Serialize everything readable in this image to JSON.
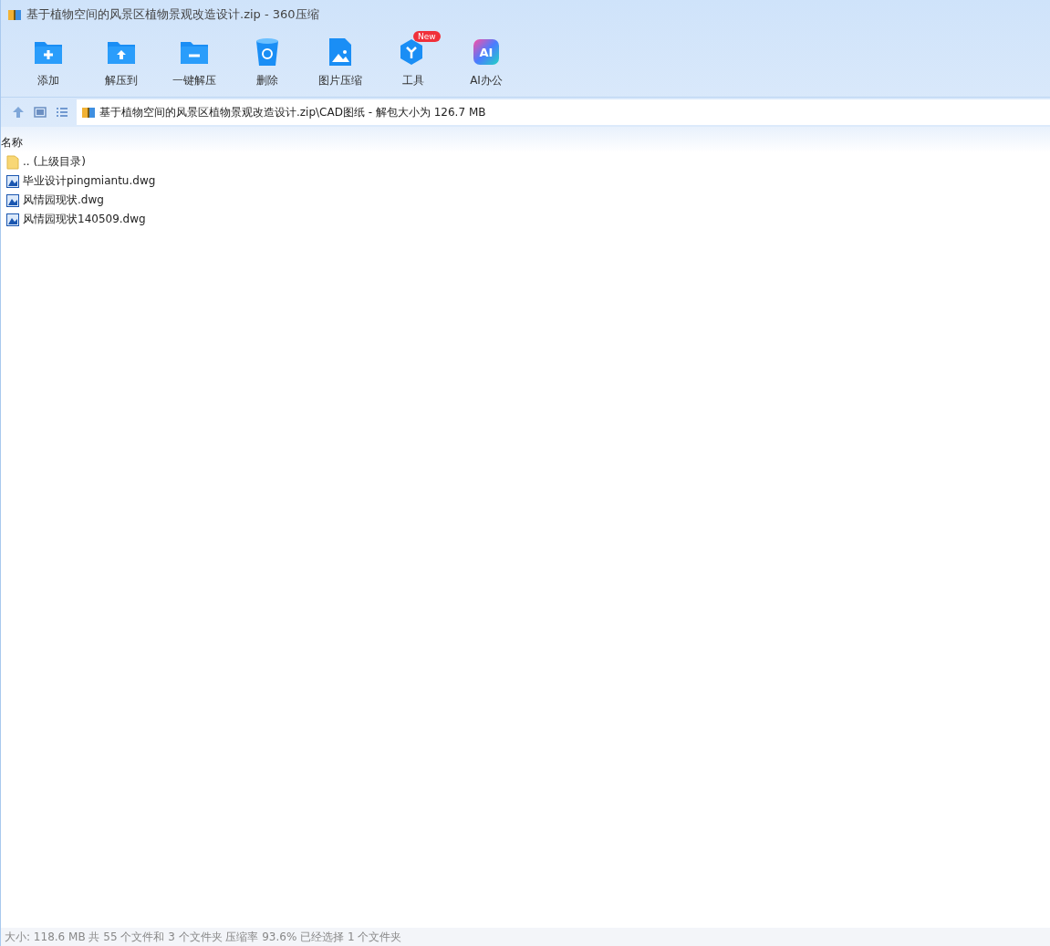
{
  "window": {
    "title": "基于植物空间的风景区植物景观改造设计.zip - 360压缩"
  },
  "toolbar": [
    {
      "kind": "add",
      "label": "添加"
    },
    {
      "kind": "extract-to",
      "label": "解压到"
    },
    {
      "kind": "one-click",
      "label": "一键解压"
    },
    {
      "kind": "delete",
      "label": "删除"
    },
    {
      "kind": "image",
      "label": "图片压缩"
    },
    {
      "kind": "tools",
      "label": "工具",
      "badge": "New"
    },
    {
      "kind": "ai",
      "label": "AI办公",
      "glyph": "AI"
    }
  ],
  "address": {
    "path": "基于植物空间的风景区植物景观改造设计.zip\\CAD图纸 - 解包大小为 126.7 MB"
  },
  "table": {
    "columns": [
      "名称"
    ],
    "rows": [
      {
        "kind": "folder",
        "name": ".. (上级目录)"
      },
      {
        "kind": "dwg",
        "name": "毕业设计pingmiantu.dwg"
      },
      {
        "kind": "dwg",
        "name": "风情园现状.dwg"
      },
      {
        "kind": "dwg",
        "name": "风情园现状140509.dwg"
      }
    ]
  },
  "status_bar": "大小: 118.6 MB 共 55 个文件和 3 个文件夹 压缩率 93.6% 已经选择 1 个文件夹"
}
